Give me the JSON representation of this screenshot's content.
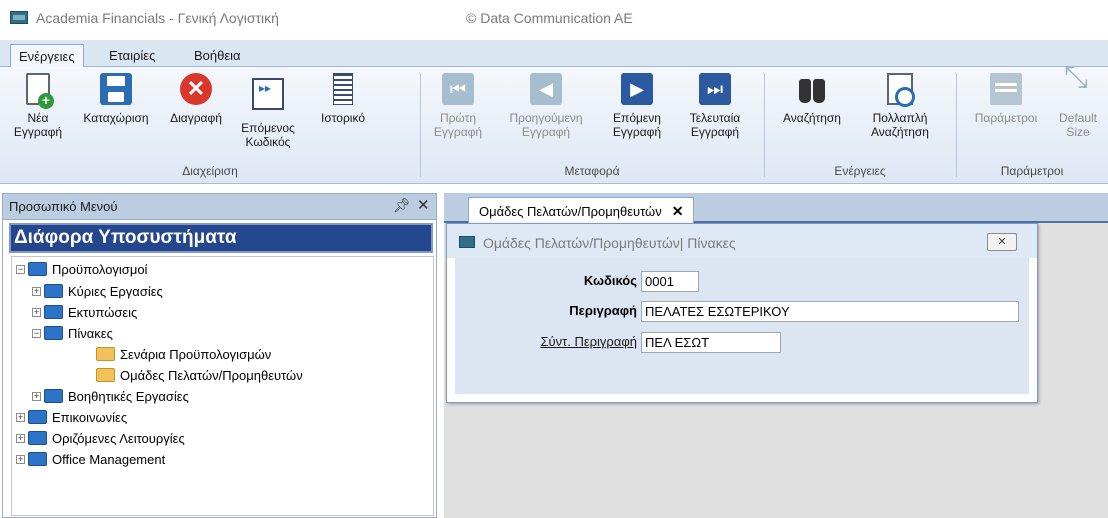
{
  "window": {
    "title": "Academia Financials - Γενική Λογιστική",
    "copyright": "© Data Communication AE"
  },
  "menu": {
    "tabs": [
      "Ενέργειες",
      "Εταιρίες",
      "Βοήθεια"
    ],
    "active": "Ενέργειες"
  },
  "ribbon": {
    "groups": {
      "management": "Διαχείριση",
      "navigation": "Μεταφορά",
      "actions": "Ενέργειες",
      "parameters": "Παράμετροι"
    },
    "buttons": {
      "new": "Νέα\nΕγγραφή",
      "save": "Καταχώριση",
      "delete": "Διαγραφή",
      "next_code": "Επόμενος\nΚωδικός",
      "history": "Ιστορικό",
      "first": "Πρώτη\nΕγγραφή",
      "previous": "Προηγούμενη\nΕγγραφή",
      "next": "Επόμενη\nΕγγραφή",
      "last": "Τελευταία\nΕγγραφή",
      "search": "Αναζήτηση",
      "multi_search": "Πολλαπλή\nΑναζήτηση",
      "parameters": "Παράμετροι",
      "default_size": "Default\nSize"
    }
  },
  "left_panel": {
    "title": "Προσωπικό Μενού",
    "subheader": "Διάφορα Υποσυστήματα",
    "tree": [
      {
        "label": "Προϋπολογισμοί",
        "expander": "−",
        "folder": "blue"
      },
      {
        "label": "Κύριες Εργασίες",
        "expander": "+",
        "folder": "blue"
      },
      {
        "label": "Εκτυπώσεις",
        "expander": "+",
        "folder": "blue"
      },
      {
        "label": "Πίνακες",
        "expander": "−",
        "folder": "blue"
      },
      {
        "label": "Σενάρια Προϋπολογισμών",
        "expander": "",
        "folder": "yellow"
      },
      {
        "label": "Ομάδες Πελατών/Προμηθευτών",
        "expander": "",
        "folder": "yellow"
      },
      {
        "label": "Βοηθητικές Εργασίες",
        "expander": "+",
        "folder": "blue"
      },
      {
        "label": "Επικοινωνίες",
        "expander": "+",
        "folder": "blue"
      },
      {
        "label": "Οριζόμενες Λειτουργίες",
        "expander": "+",
        "folder": "blue"
      },
      {
        "label": "Office Management",
        "expander": "+",
        "folder": "blue"
      }
    ]
  },
  "doc_tab": {
    "label": "Ομάδες Πελατών/Προμηθευτών",
    "close": "✕"
  },
  "form": {
    "title": "Ομάδες Πελατών/Προμηθευτών| Πίνακες",
    "close": "✕",
    "fields": {
      "code_label": "Κωδικός",
      "code_value": "0001",
      "description_label": "Περιγραφή",
      "description_value": "ΠΕΛΑΤΕΣ ΕΣΩΤΕΡΙΚΟΥ",
      "short_label": "Σύντ. Περιγραφή",
      "short_value": "ΠΕΛ ΕΣΩΤ"
    }
  }
}
